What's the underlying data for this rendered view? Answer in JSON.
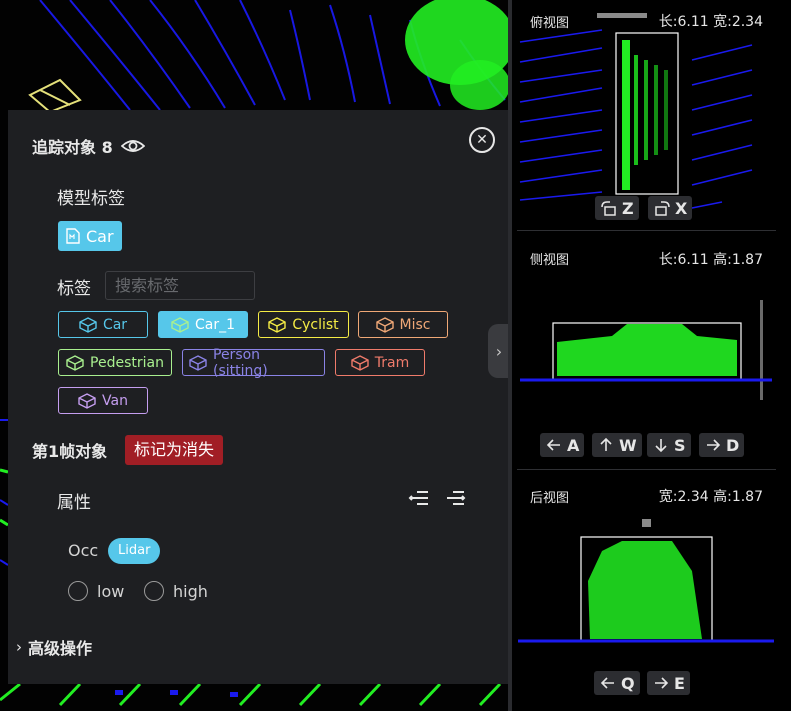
{
  "panel": {
    "title": "追踪对象 8",
    "model_label_title": "模型标签",
    "model_tag": "Car",
    "label_title": "标签",
    "search_placeholder": "搜索标签",
    "tags": [
      {
        "label": "Car",
        "color": "#56c7ea",
        "filled": false
      },
      {
        "label": "Car_1",
        "color": "#a9f08f",
        "filled": true
      },
      {
        "label": "Cyclist",
        "color": "#f5ec45",
        "filled": false
      },
      {
        "label": "Misc",
        "color": "#f0a877",
        "filled": false
      },
      {
        "label": "Pedestrian",
        "color": "#a9f08f",
        "filled": false
      },
      {
        "label": "Person (sitting)",
        "color": "#8a83e6",
        "filled": false
      },
      {
        "label": "Tram",
        "color": "#f07b6b",
        "filled": false
      },
      {
        "label": "Van",
        "color": "#c59ef0",
        "filled": false
      }
    ],
    "frame_title": "第1帧对象",
    "mark_button": "标记为消失",
    "attr_title": "属性",
    "occ_label": "Occ",
    "lidar_badge": "Lidar",
    "radio_options": [
      "low",
      "high"
    ],
    "advanced_label": "高级操作"
  },
  "views": {
    "top": {
      "title": "俯视图",
      "dims": "长:6.11 宽:2.34",
      "buttons": [
        {
          "icon": "rotate-ccw-icon",
          "label": "Z"
        },
        {
          "icon": "rotate-cw-icon",
          "label": "X"
        }
      ]
    },
    "side": {
      "title": "侧视图",
      "dims": "长:6.11 高:1.87",
      "buttons": [
        {
          "icon": "arrow-left-icon",
          "label": "A"
        },
        {
          "icon": "arrow-up-icon",
          "label": "W"
        },
        {
          "icon": "arrow-down-icon",
          "label": "S"
        },
        {
          "icon": "arrow-right-icon",
          "label": "D"
        }
      ]
    },
    "back": {
      "title": "后视图",
      "dims": "宽:2.34 高:1.87",
      "buttons": [
        {
          "icon": "arrow-left-icon",
          "label": "Q"
        },
        {
          "icon": "arrow-right-icon",
          "label": "E"
        }
      ]
    }
  },
  "colors": {
    "panel_bg": "#1e1f22",
    "accent": "#56c7ea",
    "danger": "#a11e25",
    "points_green": "#22ee22",
    "points_blue": "#1818ee"
  }
}
